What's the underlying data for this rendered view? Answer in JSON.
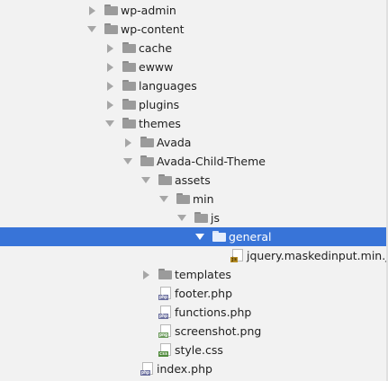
{
  "tree": {
    "items": [
      {
        "label": "wp-admin",
        "type": "folder",
        "state": "collapsed",
        "depth": 0
      },
      {
        "label": "wp-content",
        "type": "folder",
        "state": "expanded",
        "depth": 0
      },
      {
        "label": "cache",
        "type": "folder",
        "state": "collapsed",
        "depth": 1
      },
      {
        "label": "ewww",
        "type": "folder",
        "state": "collapsed",
        "depth": 1
      },
      {
        "label": "languages",
        "type": "folder",
        "state": "collapsed",
        "depth": 1
      },
      {
        "label": "plugins",
        "type": "folder",
        "state": "collapsed",
        "depth": 1
      },
      {
        "label": "themes",
        "type": "folder",
        "state": "expanded",
        "depth": 1
      },
      {
        "label": "Avada",
        "type": "folder",
        "state": "collapsed",
        "depth": 2
      },
      {
        "label": "Avada-Child-Theme",
        "type": "folder",
        "state": "expanded",
        "depth": 2
      },
      {
        "label": "assets",
        "type": "folder",
        "state": "expanded",
        "depth": 3
      },
      {
        "label": "min",
        "type": "folder",
        "state": "expanded",
        "depth": 4
      },
      {
        "label": "js",
        "type": "folder",
        "state": "expanded",
        "depth": 5
      },
      {
        "label": "general",
        "type": "folder",
        "state": "expanded",
        "depth": 6,
        "selected": true
      },
      {
        "label": "jquery.maskedinput.min.js",
        "type": "file",
        "filetype": "js",
        "depth": 7
      },
      {
        "label": "templates",
        "type": "folder",
        "state": "collapsed",
        "depth": 3
      },
      {
        "label": "footer.php",
        "type": "file",
        "filetype": "php",
        "depth": 3
      },
      {
        "label": "functions.php",
        "type": "file",
        "filetype": "php",
        "depth": 3
      },
      {
        "label": "screenshot.png",
        "type": "file",
        "filetype": "png",
        "depth": 3
      },
      {
        "label": "style.css",
        "type": "file",
        "filetype": "css",
        "depth": 3
      },
      {
        "label": "index.php",
        "type": "file",
        "filetype": "php",
        "depth": 2
      }
    ]
  },
  "colors": {
    "background": "#f2f2f2",
    "selection": "#3874d8",
    "folder": "#9b9b9b",
    "arrow": "#a6a6a6"
  }
}
